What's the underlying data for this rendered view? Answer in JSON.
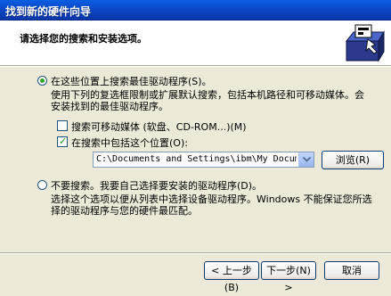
{
  "window": {
    "title": "找到新的硬件向导"
  },
  "header": {
    "subtitle": "请选择您的搜索和安装选项。",
    "icon": "hardware-wizard-icon"
  },
  "option_search": {
    "label": "在这些位置上搜索最佳驱动程序(S)。",
    "desc": "使用下列的复选框限制或扩展默认搜索，包括本机路径和可移动媒体。会安装找到的最佳驱动程序。",
    "selected": true
  },
  "check_removable": {
    "label": "搜索可移动媒体 (软盘、CD-ROM...)(M)",
    "checked": false
  },
  "check_location": {
    "label": "在搜索中包括这个位置(O):",
    "checked": true
  },
  "path": {
    "value": "C:\\Documents and Settings\\ibm\\My Documents"
  },
  "browse_button": {
    "label": "浏览(R)"
  },
  "option_manual": {
    "label": "不要搜索。我要自己选择要安装的驱动程序(D)。",
    "desc": "选择这个选项以便从列表中选择设备驱动程序。Windows 不能保证您所选择的驱动程序与您的硬件最匹配。",
    "selected": false
  },
  "buttons": {
    "back": "< 上一步(B)",
    "next": "下一步(N) >",
    "cancel": "取消"
  },
  "colors": {
    "title_bar": "#0a48c8",
    "dialog_bg": "#ece9d8",
    "radio_dot": "#2fa32a"
  }
}
